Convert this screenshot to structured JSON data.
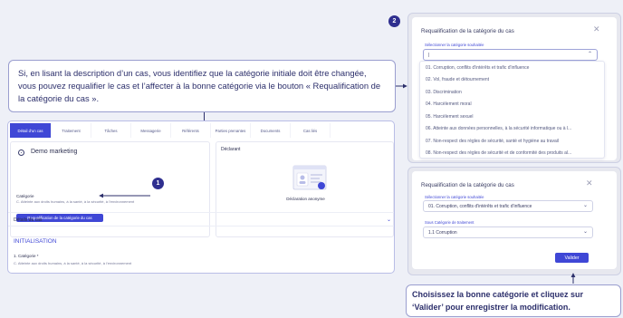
{
  "callout_main": {
    "text": "Si, en lisant la description d’un cas, vous identifiez que la  catégorie initiale doit être changée, vous pouvez requalifier le cas et l’affecter à la bonne catégorie via le bouton « Requalification de la catégorie du cas »."
  },
  "callout_bottom": {
    "text": "Choisissez la bonne catégorie et cliquez sur ‘Valider’ pour enregistrer la modification."
  },
  "badges": {
    "step1": "1",
    "step2": "2",
    "step3": "3"
  },
  "main_screen": {
    "tabs": [
      "Détail d'un cas",
      "Traitement",
      "Tâches",
      "Messagerie",
      "Référents",
      "Parties prenantes",
      "Documents",
      "Cas liés"
    ],
    "case_title": "Demo marketing",
    "category_label": "Catégorie",
    "category_value": "C. Atteinte aux droits humains, à la santé, à la sécurité, à l'environnement",
    "requalify_button": "Requalification de la catégorie du cas",
    "declarant_title": "Déclarant",
    "anonymous_text": "Déclaration anonyme",
    "details_label": "Détails du cas",
    "init_title": "INITIALISATION",
    "init_category_label": "1. Catégorie *",
    "init_category_value": "C. Atteinte aux droits humains, à la santé, à la sécurité, à l'environnement"
  },
  "modal_dropdown": {
    "title": "Requalification de la catégorie du cas",
    "field_label": "Sélectionner la catégorie souhaitée",
    "field_value": "|",
    "options": [
      "01. Corruption, conflits d'intérêts et trafic d'influence",
      "02. Vol, fraude et détournement",
      "03. Discrimination",
      "04. Harcèlement moral",
      "05. Harcèlement sexuel",
      "06. Atteinte aux données personnelles, à la sécurité informatique ou à l...",
      "07. Non-respect des règles de sécurité, santé et hygiène au travail",
      "08. Non-respect des règles de sécurité et de conformité des produits al..."
    ]
  },
  "modal_confirm": {
    "title": "Requalification de la catégorie du cas",
    "field1_label": "Sélectionner la catégorie souhaitée",
    "field1_value": "01. Corruption, conflits d'intérêts et trafic d'influence",
    "field2_label": "Sous Catégorie de traitement",
    "field2_value": "1.1 Corruption",
    "validate_button": "Valider"
  }
}
